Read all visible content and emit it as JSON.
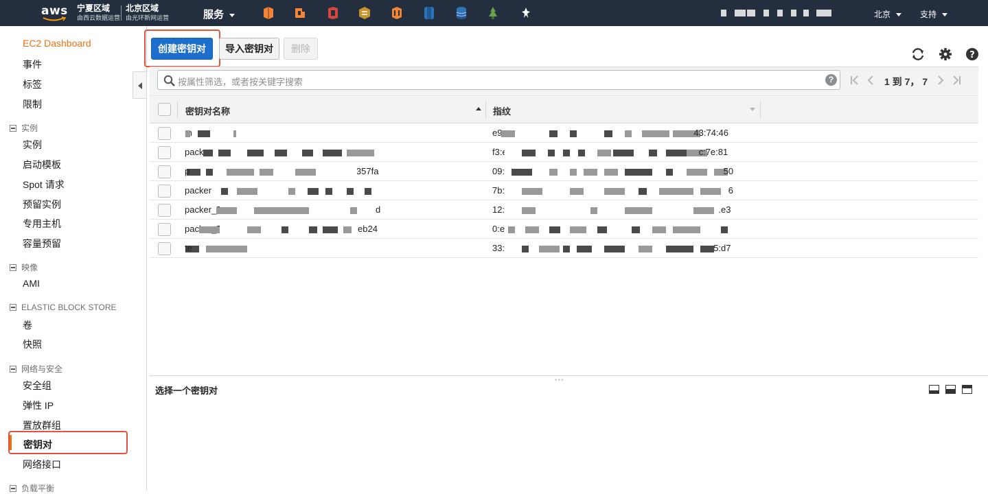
{
  "topbar": {
    "logo_text": "aws",
    "region_left": {
      "title": "宁夏区域",
      "subtitle": "由西云数据运营"
    },
    "region_right": {
      "title": "北京区域",
      "subtitle": "由光环新网运营"
    },
    "services_label": "服务",
    "service_icons": [
      "ec2-icon",
      "lambda-icon",
      "ecs-icon",
      "cloudformation-icon",
      "elb-icon",
      "s3-icon",
      "dynamodb-icon",
      "elastic-beanstalk-icon",
      "pin-icon"
    ],
    "region_menu": "北京",
    "support_menu": "支持"
  },
  "sidebar": {
    "dashboard": "EC2 Dashboard",
    "top_items": [
      "事件",
      "标签",
      "限制"
    ],
    "groups": [
      {
        "label": "实例",
        "items": [
          "实例",
          "启动模板",
          "Spot 请求",
          "预留实例",
          "专用主机",
          "容量预留"
        ]
      },
      {
        "label": "映像",
        "items": [
          "AMI"
        ]
      },
      {
        "label": "ELASTIC BLOCK STORE",
        "items": [
          "卷",
          "快照"
        ]
      },
      {
        "label": "网络与安全",
        "items": [
          "安全组",
          "弹性 IP",
          "置放群组",
          "密钥对",
          "网络接口"
        ]
      },
      {
        "label": "负载平衡",
        "items": []
      }
    ],
    "active_item": "密钥对"
  },
  "toolbar": {
    "create_label": "创建密钥对",
    "import_label": "导入密钥对",
    "delete_label": "删除"
  },
  "filter": {
    "placeholder": "按属性筛选，或者按关键字搜索",
    "pager_text": "1 到 7， 7"
  },
  "table": {
    "columns": [
      "密钥对名称",
      "指纹"
    ],
    "rows": [
      {
        "name": "m",
        "fingerprint": "e9:d3:40:0f:c4:43:74:46"
      },
      {
        "name": "pack",
        "fingerprint": "f3:e5:c7e:81"
      },
      {
        "name": "p",
        "fingerprint": "09:aa:d1:e6:4a:1357fa:50"
      },
      {
        "name": "packer",
        "fingerprint": "7b:3:c4:c7:b:6"
      },
      {
        "name": "packer_5e:0",
        "fingerprint": "12:58:f:0:e3"
      },
      {
        "name": "packer_5e:0",
        "fingerprint": "0:eb24"
      },
      {
        "name": "te",
        "fingerprint": "33:d7"
      }
    ],
    "row_tails": [
      "",
      "",
      "e4a1357fa",
      "",
      "d",
      "eb24",
      ""
    ],
    "fp_tails": [
      "43:74:46",
      "c:7e:81",
      "50",
      "6",
      ".e3",
      "",
      "5:d7"
    ]
  },
  "details": {
    "title": "选择一个密钥对"
  },
  "colors": {
    "nav_bg": "#232f3e",
    "accent_orange": "#ec7211",
    "primary_blue": "#1d6fce",
    "highlight_red": "#e3533b"
  }
}
